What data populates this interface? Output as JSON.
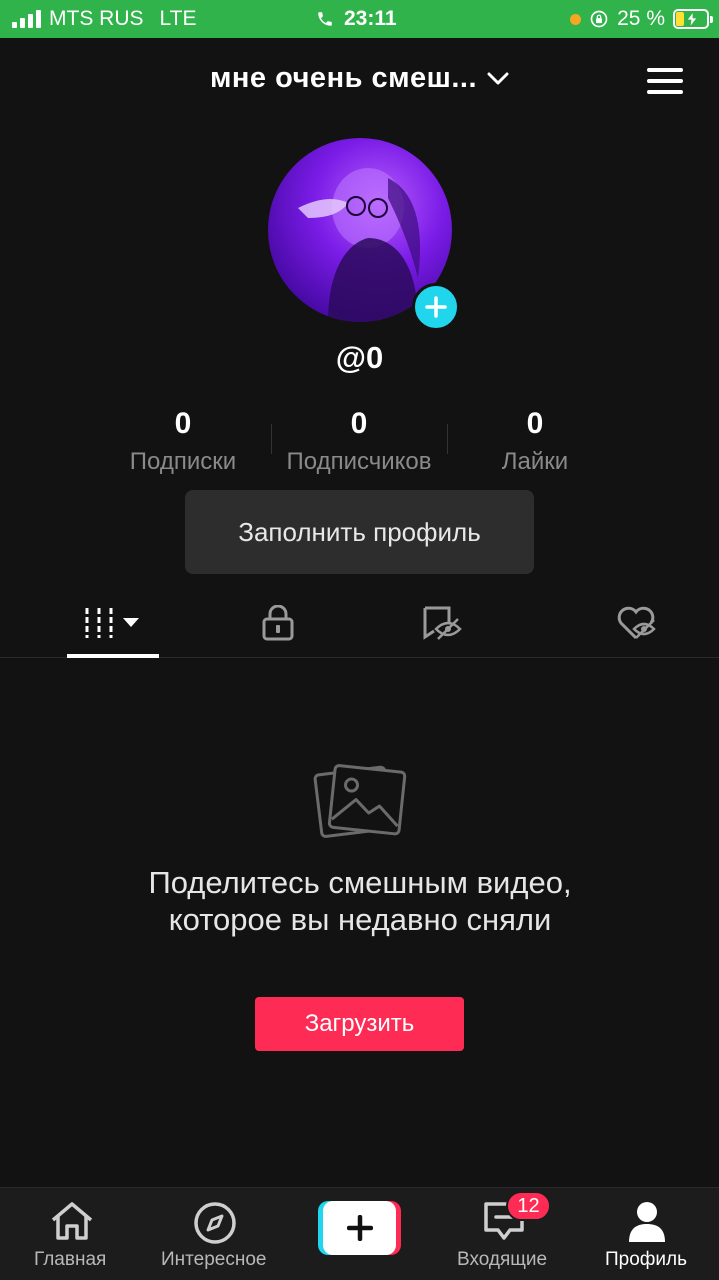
{
  "status_bar": {
    "carrier": "MTS RUS",
    "network": "LTE",
    "time": "23:11",
    "battery_percent_text": "25 %",
    "battery_level": 0.25,
    "icons": [
      "signal-icon",
      "phone-icon",
      "orange-dot",
      "rotation-lock-icon",
      "battery-charging-icon"
    ]
  },
  "header": {
    "title": "мне очень смеш...",
    "icons": [
      "chevron-down-icon",
      "menu-icon"
    ]
  },
  "profile": {
    "username": "@0",
    "stats": [
      {
        "value": "0",
        "label": "Подписки"
      },
      {
        "value": "0",
        "label": "Подписчиков"
      },
      {
        "value": "0",
        "label": "Лайки"
      }
    ],
    "fill_profile_label": "Заполнить профиль"
  },
  "tabs": [
    "videos-grid-icon",
    "private-lock-icon",
    "hidden-eye-icon",
    "liked-heart-icon"
  ],
  "empty_state": {
    "message": "Поделитесь смешным видео, которое вы недавно сняли",
    "upload_label": "Загрузить"
  },
  "bottom_nav": {
    "home": "Главная",
    "discover": "Интересное",
    "inbox": "Входящие",
    "inbox_badge": "12",
    "profile": "Профиль"
  },
  "colors": {
    "status_bar": "#31b34b",
    "background": "#121212",
    "accent_red": "#fe2c55",
    "accent_cyan": "#20d5ec"
  }
}
